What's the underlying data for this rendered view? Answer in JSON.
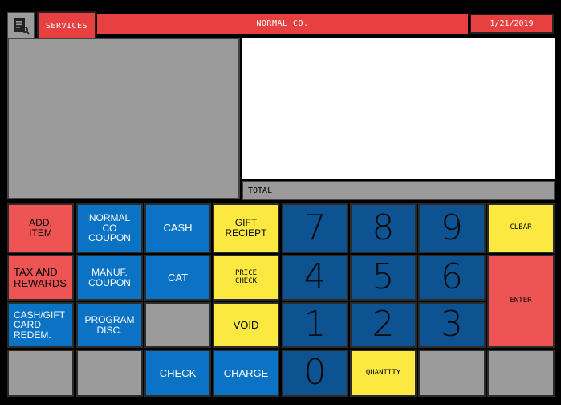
{
  "header": {
    "menu_icon": "receipt-search-icon",
    "services_label": "SERVICES",
    "company_name": "NORMAL CO.",
    "date": "1/21/2019"
  },
  "receipt": {
    "total_label": "TOTAL"
  },
  "buttons": {
    "add_item": "ADD.\nITEM",
    "tax_rewards": "TAX AND\nREWARDS",
    "cash_gift_card": "CASH/GIFT\nCARD\nREDEM.",
    "normal_co_coupon": "NORMAL\nCO\nCOUPON",
    "manuf_coupon": "MANUF.\nCOUPON",
    "program_disc": "PROGRAM\nDISC.",
    "cash": "CASH",
    "cat": "CAT",
    "check": "CHECK",
    "charge": "CHARGE",
    "gift_receipt": "GIFT\nRECIEPT",
    "price_check": "PRICE\nCHECK",
    "void": "VOID",
    "quantity": "QUANTITY",
    "clear": "CLEAR",
    "enter": "ENTER"
  },
  "keypad": {
    "d7": "7",
    "d8": "8",
    "d9": "9",
    "d4": "4",
    "d5": "5",
    "d6": "6",
    "d1": "1",
    "d2": "2",
    "d3": "3",
    "d0": "0"
  },
  "colors": {
    "red": "#ef5454",
    "blue": "#0a73c4",
    "dark_blue": "#0d5391",
    "yellow": "#fbe942",
    "gray": "#9b9b9b"
  }
}
